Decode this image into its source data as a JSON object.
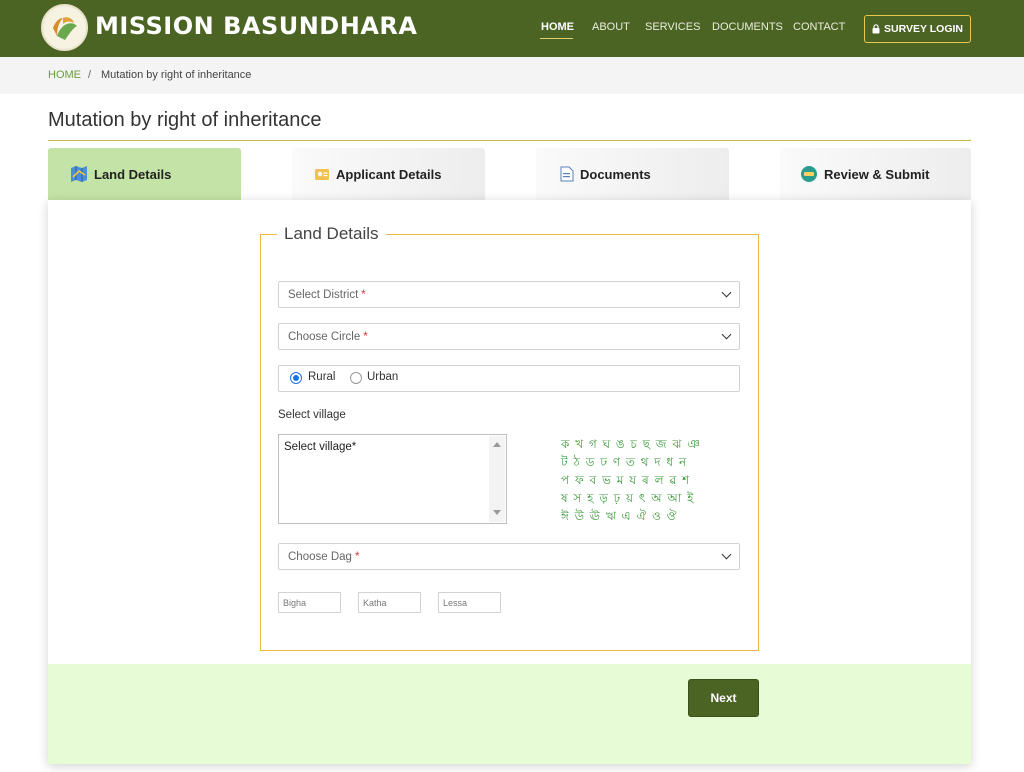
{
  "header": {
    "brand": "MISSION BASUNDHARA",
    "nav": [
      "HOME",
      "ABOUT",
      "SERVICES",
      "DOCUMENTS",
      "CONTACT"
    ],
    "survey_login": "SURVEY LOGIN",
    "colors": {
      "header_bg": "#4b6424",
      "accent": "#e6c84a"
    }
  },
  "breadcrumb": {
    "home": "HOME",
    "separator": "/",
    "current": "Mutation by right of inheritance"
  },
  "page_title": "Mutation by right of inheritance",
  "tabs": [
    {
      "label": "Land Details",
      "icon": "map-icon",
      "active": true
    },
    {
      "label": "Applicant Details",
      "icon": "user-id-icon",
      "active": false
    },
    {
      "label": "Documents",
      "icon": "document-icon",
      "active": false
    },
    {
      "label": "Review & Submit",
      "icon": "submit-icon",
      "active": false
    }
  ],
  "form": {
    "legend": "Land Details",
    "district_placeholder": "Select District",
    "circle_placeholder": "Choose Circle",
    "required_mark": "*",
    "area_type": {
      "options": [
        "Rural",
        "Urban"
      ],
      "selected": "Rural"
    },
    "village_label": "Select village",
    "village_list_placeholder": "Select village*",
    "assamese_keyboard": [
      "ক খ গ ঘ ঙ চ ছ জ ঝ ঞ",
      "ট ঠ ড ঢ ণ ত থ দ ধ  ন",
      "প ফ ব ভ ম য ৰ ল ৱ  শ",
      "ষ স হ ড় ঢ় য় ৎ অ আ ই",
      "ঈ উ ঊ ঋ এ ঐ ও ঔ"
    ],
    "dag_placeholder": "Choose Dag",
    "bigha_placeholder": "Bigha",
    "katha_placeholder": "Katha",
    "lessa_placeholder": "Lessa",
    "next_label": "Next"
  }
}
